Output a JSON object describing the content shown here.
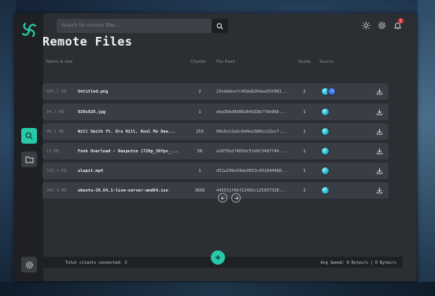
{
  "header": {
    "search_placeholder": "Search for remote files..."
  },
  "notifications": {
    "badge": "1"
  },
  "page": {
    "title": "Remote Files"
  },
  "table": {
    "headers": [
      "Name & size",
      "Chunks",
      "File Hash",
      "Seeds",
      "Source"
    ],
    "rows": [
      {
        "size": "920.1 KB",
        "name": "Untitled.png",
        "chunks": "2",
        "hash": "23edddcefc45da6264aa59f081...",
        "seeds": "2",
        "sources": [
          "user-a",
          "user-b"
        ]
      },
      {
        "size": "84.7 KB",
        "name": "920x920.jpg",
        "chunks": "1",
        "hash": "dea3bbd8986a64d18b7f9e96b...",
        "seeds": "1",
        "sources": [
          "user-a"
        ]
      },
      {
        "size": "46.1 MB",
        "name": "Will Smith ft. Dru Hill, Kool Mo Dee...",
        "chunks": "153",
        "hash": "09e5e12a2c6d4ee380ec22ec7...",
        "seeds": "1",
        "sources": [
          "user-a"
        ]
      },
      {
        "size": "13 MB",
        "name": "Funk Overload - Rasputin (720p_30fps_...",
        "chunks": "50",
        "hash": "a1975b27465bf51d9f3487744...",
        "seeds": "1",
        "sources": [
          "user-a"
        ]
      },
      {
        "size": "320.3 KB",
        "name": "ulapit.mp4",
        "chunks": "1",
        "hash": "d51a199e34de9653c431844088...",
        "seeds": "1",
        "sources": [
          "user-a"
        ]
      },
      {
        "size": "966.4 MB",
        "name": "ubuntu-20.04.1-live-server-amd64.iso",
        "chunks": "3656",
        "hash": "443511f6bf12402c125037330...",
        "seeds": "1",
        "sources": [
          "user-a"
        ]
      }
    ]
  },
  "status": {
    "clients": "Total clients connected: 3",
    "speed": "Avg Speed: 0 Bytes/s | 0 Bytes/s"
  },
  "colors": {
    "accent": "#27c9a8",
    "badge": "#e03a3a"
  }
}
